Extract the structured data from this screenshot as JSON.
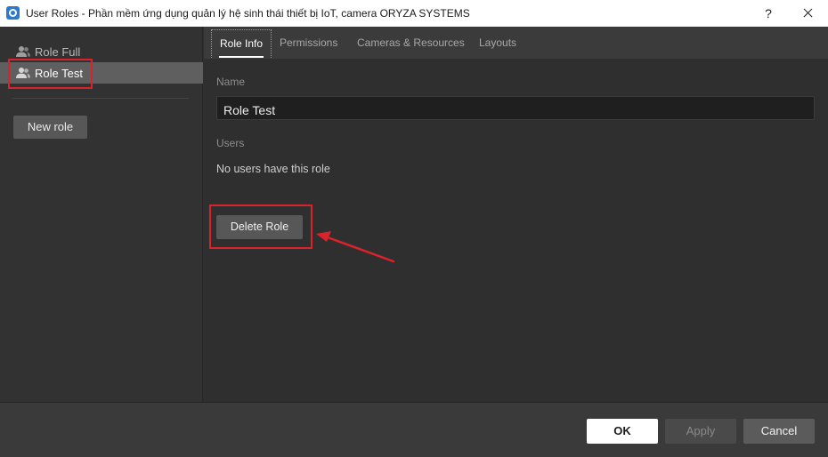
{
  "window": {
    "title": "User Roles - Phần mềm ứng dụng quản lý hệ sinh thái thiết bị IoT, camera ORYZA SYSTEMS",
    "help_label": "?"
  },
  "sidebar": {
    "roles": [
      {
        "label": "Role Full",
        "selected": false
      },
      {
        "label": "Role Test",
        "selected": true
      }
    ],
    "new_role_label": "New role"
  },
  "tabs": [
    {
      "label": "Role Info",
      "active": true
    },
    {
      "label": "Permissions",
      "active": false
    },
    {
      "label": "Cameras & Resources",
      "active": false
    },
    {
      "label": "Layouts",
      "active": false
    }
  ],
  "role_info": {
    "name_label": "Name",
    "name_value": "Role Test",
    "users_label": "Users",
    "users_empty_text": "No users have this role",
    "delete_label": "Delete Role"
  },
  "footer": {
    "ok_label": "OK",
    "apply_label": "Apply",
    "cancel_label": "Cancel"
  },
  "colors": {
    "annotation_red": "#d9232a",
    "selected_row": "#5f5f5f",
    "background": "#2f2f2f"
  },
  "icons": [
    "app-logo-icon",
    "user-group-icon",
    "close-icon",
    "help-icon"
  ]
}
